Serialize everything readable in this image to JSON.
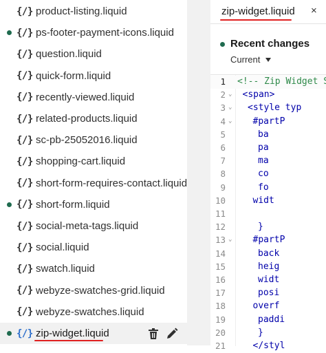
{
  "sidebar": {
    "files": [
      {
        "name": "product-listing.liquid",
        "icon": "{/}",
        "modified": false
      },
      {
        "name": "ps-footer-payment-icons.liquid",
        "icon": "{/}",
        "modified": true
      },
      {
        "name": "question.liquid",
        "icon": "{/}",
        "modified": false
      },
      {
        "name": "quick-form.liquid",
        "icon": "{/}",
        "modified": false
      },
      {
        "name": "recently-viewed.liquid",
        "icon": "{/}",
        "modified": false
      },
      {
        "name": "related-products.liquid",
        "icon": "{/}",
        "modified": false
      },
      {
        "name": "sc-pb-25052016.liquid",
        "icon": "{/}",
        "modified": false
      },
      {
        "name": "shopping-cart.liquid",
        "icon": "{/}",
        "modified": false
      },
      {
        "name": "short-form-requires-contact.liquid",
        "icon": "{/}",
        "modified": false
      },
      {
        "name": "short-form.liquid",
        "icon": "{/}",
        "modified": true
      },
      {
        "name": "social-meta-tags.liquid",
        "icon": "{/}",
        "modified": false
      },
      {
        "name": "social.liquid",
        "icon": "{/}",
        "modified": false
      },
      {
        "name": "swatch.liquid",
        "icon": "{/}",
        "modified": false
      },
      {
        "name": "webyze-swatches-grid.liquid",
        "icon": "{/}",
        "modified": false
      },
      {
        "name": "webyze-swatches.liquid",
        "icon": "{/}",
        "modified": false
      },
      {
        "name": "zip-widget.liquid",
        "icon": "{/}",
        "modified": true,
        "active": true
      }
    ],
    "active_actions": [
      "trash-icon",
      "pencil-icon"
    ]
  },
  "editor": {
    "tab": {
      "label": "zip-widget.liquid",
      "close": "×"
    },
    "recent_changes": {
      "title": "Recent changes",
      "selected": "Current"
    },
    "lines": [
      {
        "n": "1",
        "text": "<!-- Zip Widget S",
        "fold": false,
        "kind": "comment"
      },
      {
        "n": "2",
        "text": "<span>",
        "fold": true,
        "kind": "tag"
      },
      {
        "n": "3",
        "text": "<style typ",
        "fold": true,
        "kind": "tag"
      },
      {
        "n": "4",
        "text": "#partP",
        "fold": true,
        "kind": "tag"
      },
      {
        "n": "5",
        "text": "ba",
        "fold": false,
        "kind": "tag"
      },
      {
        "n": "6",
        "text": "pa",
        "fold": false,
        "kind": "tag"
      },
      {
        "n": "7",
        "text": "ma",
        "fold": false,
        "kind": "tag"
      },
      {
        "n": "8",
        "text": "co",
        "fold": false,
        "kind": "tag"
      },
      {
        "n": "9",
        "text": "fo",
        "fold": false,
        "kind": "tag"
      },
      {
        "n": "10",
        "text": "widt",
        "fold": false,
        "kind": "tag"
      },
      {
        "n": "11",
        "text": "",
        "fold": false,
        "kind": "tag"
      },
      {
        "n": "12",
        "text": "}",
        "fold": false,
        "kind": "tag"
      },
      {
        "n": "13",
        "text": "#partP",
        "fold": true,
        "kind": "tag"
      },
      {
        "n": "14",
        "text": "back",
        "fold": false,
        "kind": "tag"
      },
      {
        "n": "15",
        "text": "heig",
        "fold": false,
        "kind": "tag"
      },
      {
        "n": "16",
        "text": "widt",
        "fold": false,
        "kind": "tag"
      },
      {
        "n": "17",
        "text": "posi",
        "fold": false,
        "kind": "tag"
      },
      {
        "n": "18",
        "text": "overf",
        "fold": false,
        "kind": "tag"
      },
      {
        "n": "19",
        "text": "paddi",
        "fold": false,
        "kind": "tag"
      },
      {
        "n": "20",
        "text": "}",
        "fold": false,
        "kind": "tag"
      },
      {
        "n": "21",
        "text": "</styl",
        "fold": false,
        "kind": "tag"
      }
    ]
  },
  "colors": {
    "modified_dot": "#1f6b4f",
    "annotation": "#e02020",
    "code_text": "#0000aa",
    "comment": "#2f8a4a"
  }
}
